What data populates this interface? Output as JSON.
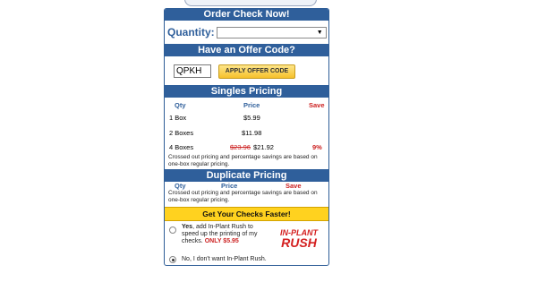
{
  "order_header": "Order Check Now!",
  "quantity": {
    "label": "Quantity:",
    "selected": ""
  },
  "offer": {
    "header": "Have an Offer Code?",
    "code_value": "QPKH",
    "apply_label": "APPLY OFFER CODE"
  },
  "singles": {
    "header": "Singles Pricing",
    "columns": {
      "qty": "Qty",
      "price": "Price",
      "save": "Save"
    },
    "rows": [
      {
        "qty": "1 Box",
        "old_price": "",
        "price": "$5.99",
        "save": ""
      },
      {
        "qty": "2 Boxes",
        "old_price": "",
        "price": "$11.98",
        "save": ""
      },
      {
        "qty": "4 Boxes",
        "old_price": "$23.96",
        "price": "$21.92",
        "save": "9%"
      }
    ],
    "note": "Crossed out pricing and percentage savings are based on one-box regular pricing."
  },
  "duplicate": {
    "header": "Duplicate Pricing",
    "columns": {
      "qty": "Qty",
      "price": "Price",
      "save": "Save"
    },
    "note": "Crossed out pricing and percentage savings are based on one-box regular pricing."
  },
  "rush": {
    "header": "Get Your Checks Faster!",
    "yes_bold": "Yes",
    "yes_text": ", add In-Plant Rush to speed up the printing of my checks.",
    "yes_price": "ONLY $5.95",
    "no_text": "No, I don't want In-Plant Rush.",
    "logo_line1": "IN-PLANT",
    "logo_line2": "RUSH",
    "selected_option": "no"
  },
  "colors": {
    "header_blue": "#2f5f9b",
    "accent_red": "#cc2222",
    "rush_yellow": "#ffd21f"
  }
}
